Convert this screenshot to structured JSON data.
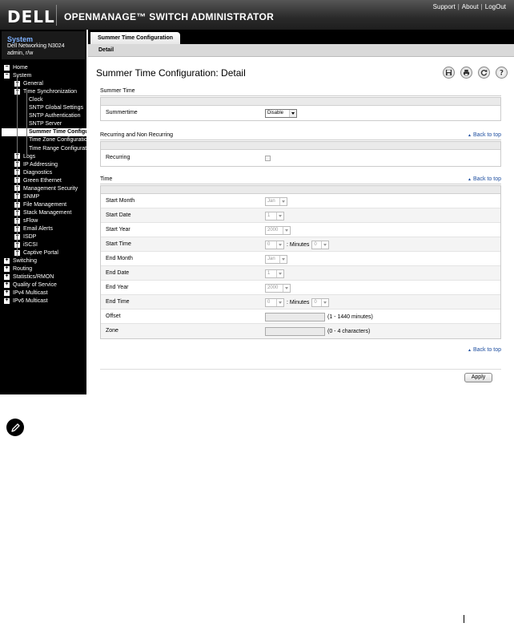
{
  "header": {
    "logo": "DELL",
    "title": "OPENMANAGE™ SWITCH ADMINISTRATOR",
    "links": [
      "Support",
      "About",
      "LogOut"
    ]
  },
  "sidebar": {
    "system_title": "System",
    "model": "Dell Networking N3024",
    "user": "admin, r/w",
    "tree": [
      {
        "label": "Home",
        "box": "-"
      },
      {
        "label": "System",
        "box": "-"
      },
      {
        "label": "General",
        "box": "+"
      },
      {
        "label": "Time Synchronization",
        "box": "-"
      },
      {
        "label": "Clock",
        "box": ""
      },
      {
        "label": "SNTP Global Settings",
        "box": ""
      },
      {
        "label": "SNTP Authentication",
        "box": ""
      },
      {
        "label": "SNTP Server",
        "box": ""
      },
      {
        "label": "Summer Time Configuration",
        "box": "",
        "selected": true
      },
      {
        "label": "Time Zone Configuration",
        "box": ""
      },
      {
        "label": "Time Range Configuration",
        "box": ""
      },
      {
        "label": "Logs",
        "box": "+"
      },
      {
        "label": "IP Addressing",
        "box": "+"
      },
      {
        "label": "Diagnostics",
        "box": "+"
      },
      {
        "label": "Green Ethernet",
        "box": "+"
      },
      {
        "label": "Management Security",
        "box": "+"
      },
      {
        "label": "SNMP",
        "box": "+"
      },
      {
        "label": "File Management",
        "box": "+"
      },
      {
        "label": "Stack Management",
        "box": "+"
      },
      {
        "label": "sFlow",
        "box": "+"
      },
      {
        "label": "Email Alerts",
        "box": "+"
      },
      {
        "label": "ISDP",
        "box": "+"
      },
      {
        "label": "iSCSI",
        "box": "+"
      },
      {
        "label": "Captive Portal",
        "box": "+"
      },
      {
        "label": "Switching",
        "box": "+"
      },
      {
        "label": "Routing",
        "box": "+"
      },
      {
        "label": "Statistics/RMON",
        "box": "+"
      },
      {
        "label": "Quality of Service",
        "box": "+"
      },
      {
        "label": "IPv4 Multicast",
        "box": "+"
      },
      {
        "label": "IPv6 Multicast",
        "box": "+"
      }
    ]
  },
  "content": {
    "tab": "Summer Time Configuration",
    "subtab": "Detail",
    "page_title": "Summer Time Configuration: Detail",
    "icons": [
      "save-icon",
      "print-icon",
      "refresh-icon",
      "help-icon"
    ],
    "back_to_top": "Back to top",
    "summer_time": {
      "section_label": "Summer Time",
      "label": "Summertime",
      "value": "Disable"
    },
    "recurring": {
      "section_label": "Recurring and Non Recurring",
      "label": "Recurring"
    },
    "time": {
      "section_label": "Time",
      "start_month": {
        "label": "Start Month",
        "value": "Jan"
      },
      "start_date": {
        "label": "Start Date",
        "value": "1"
      },
      "start_year": {
        "label": "Start Year",
        "value": "2000"
      },
      "start_time": {
        "label": "Start Time",
        "hour": "0",
        "minutes_label": ": Minutes",
        "minute": "0"
      },
      "end_month": {
        "label": "End Month",
        "value": "Jan"
      },
      "end_date": {
        "label": "End Date",
        "value": "1"
      },
      "end_year": {
        "label": "End Year",
        "value": "2000"
      },
      "end_time": {
        "label": "End Time",
        "hour": "0",
        "minutes_label": ": Minutes",
        "minute": "0"
      },
      "offset": {
        "label": "Offset",
        "hint": "(1 - 1440 minutes)"
      },
      "zone": {
        "label": "Zone",
        "hint": "(0 - 4 characters)"
      }
    },
    "apply_label": "Apply"
  },
  "colors": {
    "header_bg": "#2a2a2a",
    "sidebar_bg": "#000000",
    "system_title": "#7fb2ff",
    "link": "#1f4fa0"
  }
}
